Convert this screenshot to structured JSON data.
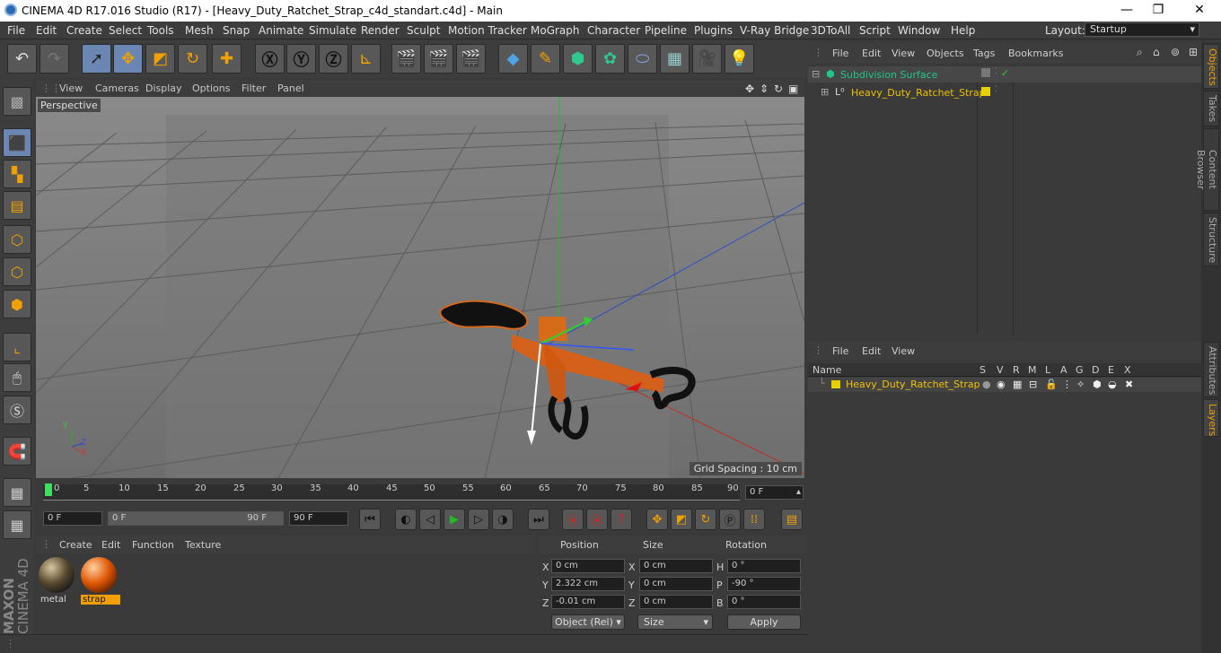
{
  "title": "CINEMA 4D R17.016 Studio (R17) - [Heavy_Duty_Ratchet_Strap_c4d_standart.c4d] - Main",
  "window_controls": {
    "minimize": "—",
    "maximize": "❐",
    "close": "✕"
  },
  "menu": [
    "File",
    "Edit",
    "Create",
    "Select",
    "Tools",
    "Mesh",
    "Snap",
    "Animate",
    "Simulate",
    "Render",
    "Sculpt",
    "Motion Tracker",
    "MoGraph",
    "Character",
    "Pipeline",
    "Plugins",
    "V-Ray Bridge",
    "3DToAll",
    "Script",
    "Window",
    "Help"
  ],
  "layout": {
    "label": "Layout:",
    "value": "Startup"
  },
  "viewport": {
    "menu": [
      "View",
      "Cameras",
      "Display",
      "Options",
      "Filter",
      "Panel"
    ],
    "camera_label": "Perspective",
    "grid_spacing": "Grid Spacing : 10 cm",
    "axis_labels": {
      "y": "Y",
      "z": "Z",
      "x": "X"
    }
  },
  "timeline": {
    "ticks": [
      "0",
      "5",
      "10",
      "15",
      "20",
      "25",
      "30",
      "35",
      "40",
      "45",
      "50",
      "55",
      "60",
      "65",
      "70",
      "75",
      "80",
      "85",
      "90"
    ],
    "current": "0 F",
    "start_field": "0 F",
    "range_start": "0 F",
    "range_end": "90 F",
    "end_field": "90 F"
  },
  "material_manager": {
    "menu": [
      "Create",
      "Edit",
      "Function",
      "Texture"
    ],
    "materials": [
      {
        "name": "metal"
      },
      {
        "name": "strap"
      }
    ]
  },
  "coords": {
    "headers": [
      "Position",
      "Size",
      "Rotation"
    ],
    "rows": [
      {
        "axis": "X",
        "pos": "0 cm",
        "size_axis": "X",
        "size": "0 cm",
        "rot_axis": "H",
        "rot": "0 °"
      },
      {
        "axis": "Y",
        "pos": "2.322 cm",
        "size_axis": "Y",
        "size": "0 cm",
        "rot_axis": "P",
        "rot": "-90 °"
      },
      {
        "axis": "Z",
        "pos": "-0.01 cm",
        "size_axis": "Z",
        "size": "0 cm",
        "rot_axis": "B",
        "rot": "0 °"
      }
    ],
    "mode": "Object (Rel)",
    "size_mode": "Size",
    "apply": "Apply"
  },
  "object_manager": {
    "menu": [
      "File",
      "Edit",
      "View",
      "Objects",
      "Tags",
      "Bookmarks"
    ],
    "items": [
      "Subdivision Surface",
      "Heavy_Duty_Ratchet_Strap"
    ]
  },
  "layer_manager": {
    "menu": [
      "File",
      "Edit",
      "View"
    ],
    "col_name": "Name",
    "cols": [
      "S",
      "V",
      "R",
      "M",
      "L",
      "A",
      "G",
      "D",
      "E",
      "X"
    ],
    "layers": [
      "Heavy_Duty_Ratchet_Strap"
    ]
  },
  "side_tabs": [
    "Objects",
    "Takes",
    "Content Browser",
    "Structure",
    "Attributes",
    "Layers"
  ],
  "brand": {
    "maxon": "MAXON",
    "product": "CINEMA 4D"
  },
  "colors": {
    "accent": "#f0a000",
    "selected": "#6b86b3",
    "layer": "#e6d000",
    "object_green": "#1fc78a"
  }
}
